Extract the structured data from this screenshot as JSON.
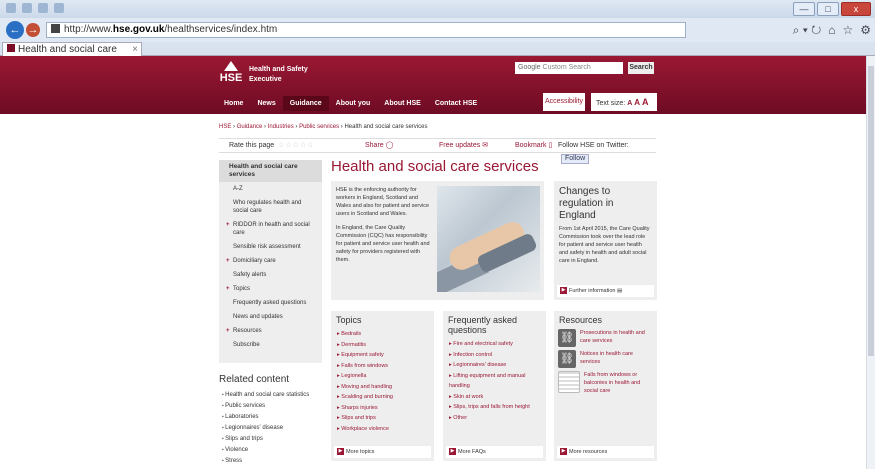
{
  "browser": {
    "url_prefix": "http://www.",
    "url_host": "hse.gov.uk",
    "url_path": "/healthservices/index.htm",
    "tab_title": "Health and social care services",
    "tab_close": "×",
    "window_buttons": {
      "minimize": "—",
      "maximize": "□",
      "close": "x"
    },
    "nav": {
      "back": "←",
      "forward": "→"
    },
    "tools": [
      "⌕ ▾ ↻",
      "⌂",
      "☆",
      "⚙"
    ]
  },
  "header": {
    "logo_text": "HSE",
    "org_name": "Health and Safety Executive",
    "search_brand": "Google",
    "search_placeholder": "Custom Search",
    "search_button": "Search",
    "nav_items": [
      "Home",
      "News",
      "Guidance",
      "About you",
      "About HSE",
      "Contact HSE"
    ],
    "active_nav": "Guidance",
    "accessibility": "Accessibility",
    "text_size_label": "Text size:",
    "text_sizes": [
      "A",
      "A",
      "A"
    ]
  },
  "breadcrumb": {
    "links": [
      "HSE",
      "Guidance",
      "Industries",
      "Public services"
    ],
    "sep": " › ",
    "current": "Health and social care services"
  },
  "toolbar": {
    "rate_label": "Rate this page",
    "stars": "☆☆☆☆☆",
    "share": "Share",
    "free_updates": "Free updates",
    "bookmark": "Bookmark",
    "twitter_label": "Follow HSE on Twitter:",
    "follow": "Follow"
  },
  "sidenav": {
    "items": [
      {
        "label": "Health and social care services",
        "current": true,
        "plus": false
      },
      {
        "label": "A-Z",
        "plus": false
      },
      {
        "label": "Who regulates health and social care",
        "plus": false
      },
      {
        "label": "RIDDOR in health and social care",
        "plus": true
      },
      {
        "label": "Sensible risk assessment",
        "plus": false
      },
      {
        "label": "Domiciliary care",
        "plus": true
      },
      {
        "label": "Safety alerts",
        "plus": false
      },
      {
        "label": "Topics",
        "plus": true
      },
      {
        "label": "Frequently asked questions",
        "plus": false
      },
      {
        "label": "News and updates",
        "plus": false
      },
      {
        "label": "Resources",
        "plus": true
      },
      {
        "label": "Subscribe",
        "plus": false
      }
    ]
  },
  "related": {
    "title": "Related content",
    "items": [
      "Health and social care statistics",
      "Public services",
      "Laboratories",
      "Legionnaires' disease",
      "Slips and trips",
      "Violence",
      "Stress"
    ]
  },
  "main": {
    "title": "Health and social care services",
    "intro_p1": "HSE is the enforcing authority for workers in England, Scotland and Wales and also for patient and service users in Scotland and Wales.",
    "intro_p2": "In England, the Care Quality Commission (CQC) has responsibility for patient and service user health and safety for providers registered with them.",
    "changes_title": "Changes to regulation in England",
    "changes_text": "From 1st April 2015, the Care Quality Commission took over the lead role for patient and service user health and safety in health and adult social care in England.",
    "changes_link": "Further information"
  },
  "topics": {
    "title": "Topics",
    "items": [
      "Bedrails",
      "Dermatitis",
      "Equipment safety",
      "Falls from windows",
      "Legionella",
      "Moving and handling",
      "Scalding and burning",
      "Sharps injuries",
      "Slips and trips",
      "Workplace violence"
    ],
    "more": "More topics"
  },
  "faqs": {
    "title": "Frequently asked questions",
    "items": [
      "Fire and electrical safety",
      "Infection control",
      "Legionnaires' disease",
      "Lifting equipment and manual handling",
      "Skin at work",
      "Slips, trips and falls from height",
      "Other"
    ],
    "more": "More FAQs"
  },
  "resources": {
    "title": "Resources",
    "items": [
      "Prosecutions in health and care services",
      "Notices in health care services",
      "Falls from windows or balconies in health and social care"
    ],
    "more": "More resources"
  }
}
